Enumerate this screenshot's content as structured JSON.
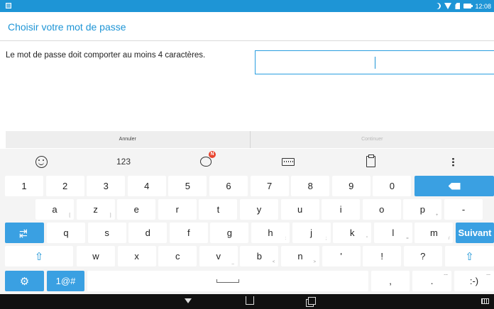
{
  "status_bar": {
    "time": "12:08"
  },
  "header": {
    "title": "Choisir votre mot de passe"
  },
  "main": {
    "message": "Le mot de passe doit comporter au moins 4 caractères.",
    "password_value": ""
  },
  "actions": {
    "cancel": "Annuler",
    "continue": "Continuer"
  },
  "keyboard": {
    "toolbar": {
      "numbers": "123",
      "badge": "N"
    },
    "row1": [
      "1",
      "2",
      "3",
      "4",
      "5",
      "6",
      "7",
      "8",
      "9",
      "0"
    ],
    "row2": [
      {
        "k": "a",
        "s": "["
      },
      {
        "k": "z",
        "s": "]"
      },
      {
        "k": "e",
        "s": ""
      },
      {
        "k": "r",
        "s": ""
      },
      {
        "k": "t",
        "s": ""
      },
      {
        "k": "y",
        "s": ""
      },
      {
        "k": "u",
        "s": ""
      },
      {
        "k": "i",
        "s": ""
      },
      {
        "k": "o",
        "s": ""
      },
      {
        "k": "p",
        "s": "+"
      },
      {
        "k": "-",
        "s": ""
      }
    ],
    "row3": [
      {
        "k": "q",
        "s": ""
      },
      {
        "k": "s",
        "s": ""
      },
      {
        "k": "d",
        "s": ""
      },
      {
        "k": "f",
        "s": ""
      },
      {
        "k": "g",
        "s": ""
      },
      {
        "k": "h",
        "s": ":"
      },
      {
        "k": "j",
        "s": ";"
      },
      {
        "k": "k",
        "s": "\""
      },
      {
        "k": "l",
        "s": "="
      },
      {
        "k": "m",
        "s": "/"
      }
    ],
    "suivant": "Suivant",
    "row4": [
      {
        "k": "w",
        "s": ""
      },
      {
        "k": "x",
        "s": ""
      },
      {
        "k": "c",
        "s": ""
      },
      {
        "k": "v",
        "s": "_"
      },
      {
        "k": "b",
        "s": "<"
      },
      {
        "k": "n",
        "s": ">"
      },
      {
        "k": "'",
        "s": ""
      },
      {
        "k": "!",
        "s": ""
      },
      {
        "k": "?",
        "s": ""
      }
    ],
    "symbols": "1@#",
    "comma": ",",
    "period": ".",
    "smiley": ":-)",
    "more_dots": "..."
  }
}
